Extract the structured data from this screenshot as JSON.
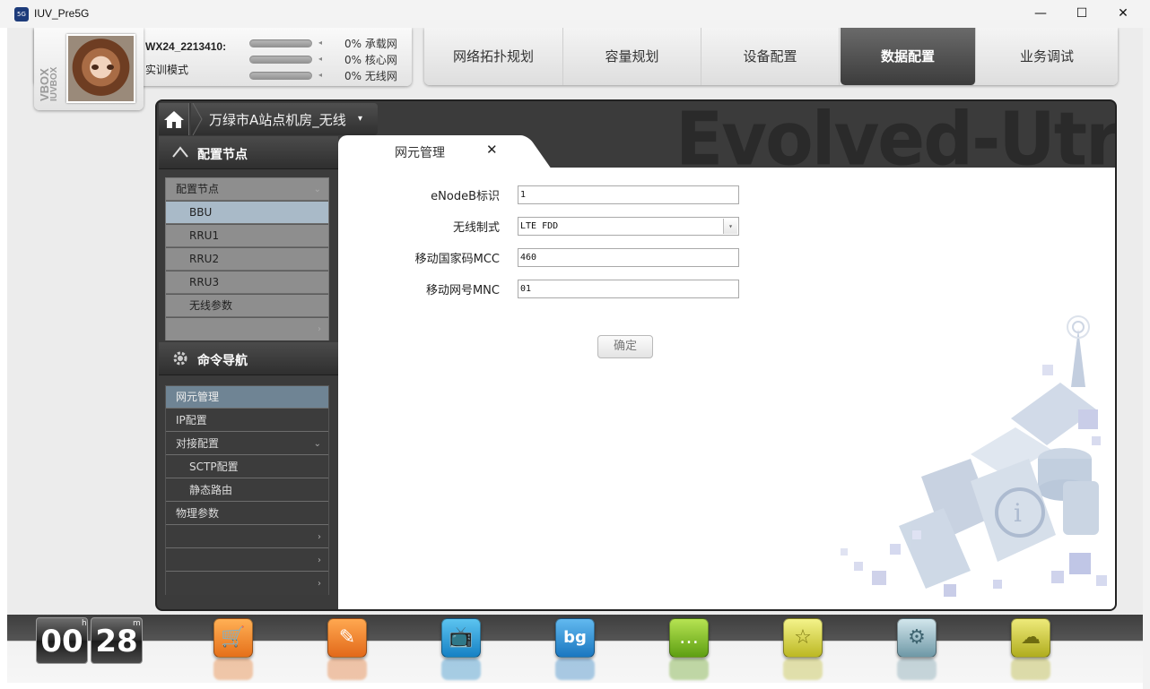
{
  "window": {
    "title": "IUV_Pre5G",
    "icon": "5G",
    "minimize": "—",
    "maximize": "☐",
    "close": "✕"
  },
  "profile": {
    "vbox_text": "VBOX",
    "iuvbox_text": "IUVBOX",
    "user_name": "WX24_2213410:",
    "mode": "实训模式",
    "progress": [
      {
        "label": "0% 承载网",
        "value": 0
      },
      {
        "label": "0% 核心网",
        "value": 0
      },
      {
        "label": "0% 无线网",
        "value": 0
      }
    ]
  },
  "nav": {
    "items": [
      "网络拓扑规划",
      "容量规划",
      "设备配置",
      "数据配置",
      "业务调试"
    ],
    "active_index": 3
  },
  "banner": {
    "background_title": "Evolved-Utran"
  },
  "breadcrumb": {
    "location": "万绿市A站点机房_无线",
    "caret": "▾"
  },
  "config_nodes": {
    "header": "配置节点",
    "group_label": "配置节点",
    "items": [
      "BBU",
      "RRU1",
      "RRU2",
      "RRU3",
      "无线参数"
    ],
    "selected": "BBU"
  },
  "command_nav": {
    "header": "命令导航",
    "items": [
      "网元管理",
      "IP配置",
      "对接配置",
      "SCTP配置",
      "静态路由",
      "物理参数"
    ],
    "selected": "网元管理"
  },
  "tab": {
    "title": "网元管理",
    "close": "✕"
  },
  "form": {
    "fields": [
      {
        "label": "eNodeB标识",
        "value": "1"
      },
      {
        "label": "无线制式",
        "value": "LTE FDD"
      },
      {
        "label": "移动国家码MCC",
        "value": "460"
      },
      {
        "label": "移动网号MNC",
        "value": "01"
      }
    ],
    "dropdown_arrow": "▾",
    "submit": "确定"
  },
  "clock": {
    "hours": "00",
    "minutes": "28",
    "h_unit": "h",
    "m_unit": "m"
  },
  "dock": {
    "icons": [
      {
        "name": "cart-icon",
        "glyph": "🛒",
        "color": "#f08a24"
      },
      {
        "name": "notebook-icon",
        "glyph": "✎",
        "color": "#ef7d22"
      },
      {
        "name": "tv-icon",
        "glyph": "📺",
        "color": "#1e9ad6"
      },
      {
        "name": "calendar-bg-icon",
        "glyph": "bg",
        "color": "#2a8fd0"
      },
      {
        "name": "chat-icon",
        "glyph": "…",
        "color": "#7fbf2a"
      },
      {
        "name": "star-icon",
        "glyph": "☆",
        "color": "#d8d63a"
      },
      {
        "name": "gear-icon",
        "glyph": "⚙",
        "color": "#8fb3bf"
      },
      {
        "name": "cloud-icon",
        "glyph": "☁",
        "color": "#c9c83a"
      }
    ]
  }
}
